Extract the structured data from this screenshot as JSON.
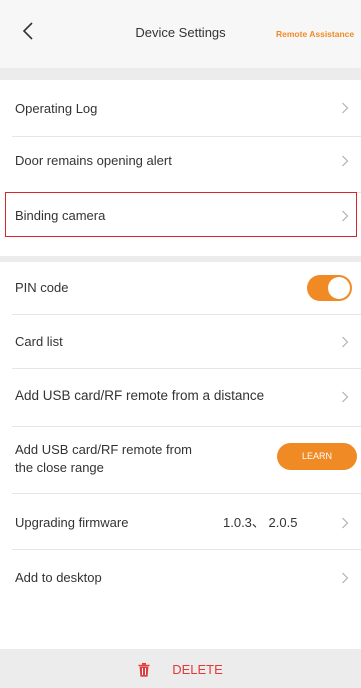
{
  "header": {
    "title": "Device Settings",
    "remote_label": "Remote Assistance",
    "back_icon": "chevron-left-icon"
  },
  "group1": {
    "items": [
      {
        "label": "Operating Log"
      },
      {
        "label": "Door remains opening alert"
      },
      {
        "label": "Binding camera"
      }
    ]
  },
  "group2": {
    "pin_label": "PIN code",
    "pin_enabled": true,
    "card_list_label": "Card list",
    "add_distance_label": "Add USB card/RF remote from a distance",
    "add_close_label_line1": "Add USB card/RF remote from",
    "add_close_label_line2": "the close range",
    "learn_label": "LEARN",
    "firmware_label": "Upgrading firmware",
    "firmware_version": "1.0.3、 2.0.5",
    "desktop_label": "Add to desktop"
  },
  "footer": {
    "delete_label": "DELETE",
    "delete_icon": "trash-icon"
  },
  "colors": {
    "accent": "#f08a24",
    "delete": "#e03a3a",
    "highlight": "#d9262c"
  }
}
